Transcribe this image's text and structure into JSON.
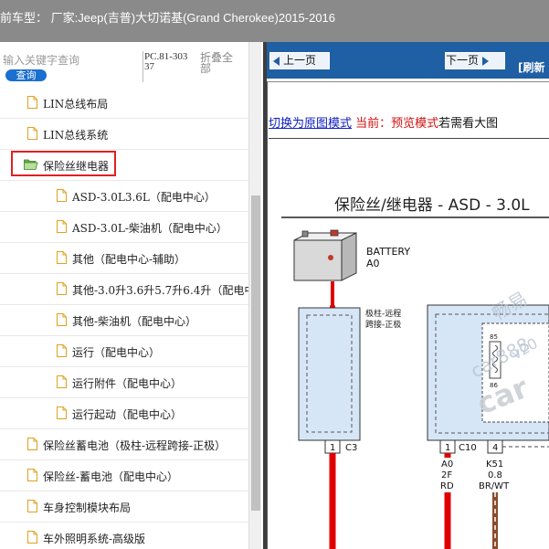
{
  "header": {
    "title": "前车型：  厂家:Jeep(吉普)大切诺基(Grand Cherokee)2015-2016"
  },
  "search": {
    "placeholder": "输入关键字查询",
    "button_label": "查询",
    "pc_code": "PC.81-30337",
    "collapse_label": "折叠全部"
  },
  "tree": {
    "items": [
      {
        "label": "LIN总线布局",
        "level": 1,
        "icon": "document-icon"
      },
      {
        "label": "LIN总线系统",
        "level": 1,
        "icon": "document-icon"
      },
      {
        "label": "保险丝继电器",
        "level": 1,
        "icon": "folder-open-icon",
        "selected": true
      },
      {
        "label": "ASD-3.0L3.6L（配电中心）",
        "level": 2,
        "icon": "document-icon"
      },
      {
        "label": "ASD-3.0L-柴油机（配电中心）",
        "level": 2,
        "icon": "document-icon"
      },
      {
        "label": "其他（配电中心-辅助）",
        "level": 2,
        "icon": "document-icon"
      },
      {
        "label": "其他-3.0升3.6升5.7升6.4升（配电中",
        "level": 2,
        "icon": "document-icon"
      },
      {
        "label": "其他-柴油机（配电中心）",
        "level": 2,
        "icon": "document-icon"
      },
      {
        "label": "运行（配电中心）",
        "level": 2,
        "icon": "document-icon"
      },
      {
        "label": "运行附件（配电中心）",
        "level": 2,
        "icon": "document-icon"
      },
      {
        "label": "运行起动（配电中心）",
        "level": 2,
        "icon": "document-icon"
      },
      {
        "label": "保险丝蓄电池（极柱-远程跨接-正极）",
        "level": 1,
        "icon": "document-icon"
      },
      {
        "label": "保险丝-蓄电池（配电中心）",
        "level": 1,
        "icon": "document-icon"
      },
      {
        "label": "车身控制模块布局",
        "level": 1,
        "icon": "document-icon"
      },
      {
        "label": "车外照明系统-高级版",
        "level": 1,
        "icon": "document-icon"
      }
    ]
  },
  "nav": {
    "prev_label": "上一页",
    "next_label": "下一页",
    "refresh_label": "[刷新"
  },
  "viewer": {
    "switch_link": "切换为原图模式",
    "current_mode": "当前：预览模式",
    "hint": "若需看大图"
  },
  "diagram": {
    "title": "保险丝/继电器 - ASD - 3.0L",
    "battery_label": "BATTERY",
    "battery_code": "A0",
    "terminal_label_1": "极柱-远程",
    "terminal_label_2": "跨接-正极",
    "conn1_pin": "1",
    "conn1_name": "C3",
    "conn2_pin": "1",
    "conn2_name": "C10",
    "conn3_pin": "4",
    "wire1_code": "A0",
    "wire1_gauge": "2F",
    "wire1_color": "RD",
    "wire2_code": "K51",
    "wire2_gauge": "0.8",
    "wire2_color": "BR/WT",
    "relay_pin_a": "85",
    "relay_pin_b": "86",
    "watermark_1": "畅易",
    "watermark_2": "car888",
    "watermark_3": "car",
    "watermark_4": "v20"
  },
  "colors": {
    "title_bar": "#8a8a8a",
    "nav_bar": "#1f5fa3",
    "search_button": "#1a6fd0",
    "selection_border": "#e02020",
    "wire_red": "#e00000",
    "module_fill": "#d6e6f7"
  }
}
